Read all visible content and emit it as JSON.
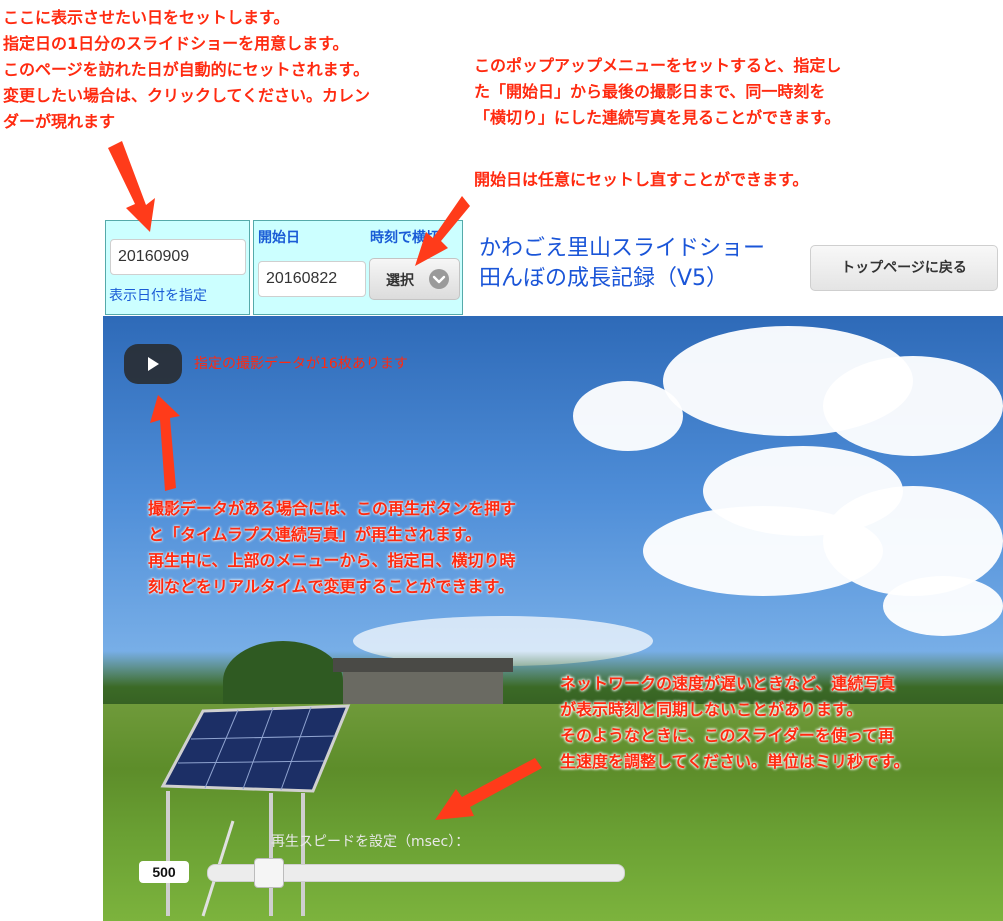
{
  "annotations": {
    "top_left": [
      "ここに表示させたい日をセットします。",
      "指定日の1日分のスライドショーを用意します。",
      "このページを訪れた日が自動的にセットされます。",
      "変更したい場合は、クリックしてください。カレン",
      "ダーが現れます"
    ],
    "top_right": [
      "このポップアップメニューをセットすると、指定し",
      "た「開始日」から最後の撮影日まで、同一時刻を",
      "「横切り」にした連続写真を見ることができます。"
    ],
    "start_date_note": "開始日は任意にセットし直すことができます。",
    "play_note": [
      "撮影データがある場合には、この再生ボタンを押す",
      "と「タイムラプス連続写真」が再生されます。",
      "再生中に、上部のメニューから、指定日、横切り時",
      "刻などをリアルタイムで変更することができます。"
    ],
    "slider_note": [
      "ネットワークの速度が遅いときなど、連続写真",
      "が表示時刻と同期しないことがあります。",
      "そのようなときに、このスライダーを使って再",
      "生速度を調整してください。単位はミリ秒です。"
    ]
  },
  "header": {
    "date_value": "20160909",
    "date_label": "表示日付を指定",
    "start_label": "開始日",
    "time_label": "時刻で横切",
    "start_value": "20160822",
    "select_label": "選択",
    "title_line1": "かわごえ里山スライドショー",
    "title_line2": "田んぼの成長記録（V5）",
    "top_button": "トップページに戻る"
  },
  "player": {
    "count_text": "指定の撮影データが16枚あります",
    "speed_label": "再生スピードを設定（msec）：",
    "speed_value": "500",
    "speed_fraction": 0.12
  },
  "colors": {
    "annotation": "#ff2a10",
    "title": "#1a55d8",
    "panel": "#ccffff"
  }
}
